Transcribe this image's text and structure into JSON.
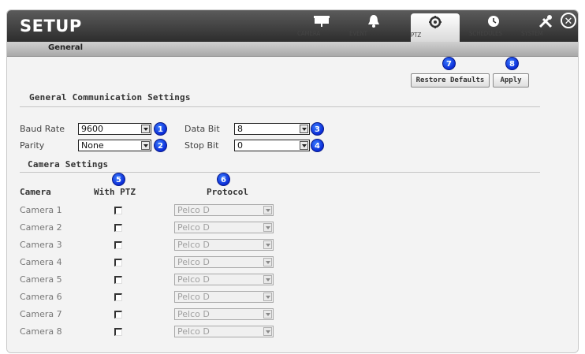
{
  "header": {
    "title": "SETUP",
    "nav": [
      {
        "label": "CAMERA",
        "icon": "camera-icon"
      },
      {
        "label": "EVENT",
        "icon": "bell-icon"
      },
      {
        "label": "PTZ",
        "icon": "ptz-icon",
        "active": true
      },
      {
        "label": "SCHEDULES",
        "icon": "clock-icon"
      },
      {
        "label": "SYSTEM",
        "icon": "tools-icon"
      }
    ],
    "close_glyph": "✕"
  },
  "subbar": {
    "tab": "General"
  },
  "toolbar": {
    "restore_label": "Restore Defaults",
    "apply_label": "Apply",
    "restore_badge": "7",
    "apply_badge": "8"
  },
  "general": {
    "title": "General Communication Settings",
    "baud_label": "Baud Rate",
    "baud_value": "9600",
    "baud_badge": "1",
    "parity_label": "Parity",
    "parity_value": "None",
    "parity_badge": "2",
    "databit_label": "Data Bit",
    "databit_value": "8",
    "databit_badge": "3",
    "stopbit_label": "Stop Bit",
    "stopbit_value": "0",
    "stopbit_badge": "4"
  },
  "camera_settings": {
    "title": "Camera Settings",
    "col_camera": "Camera",
    "col_ptz": "With PTZ",
    "col_protocol": "Protocol",
    "ptz_badge": "5",
    "protocol_badge": "6",
    "rows": [
      {
        "name": "Camera 1",
        "ptz": false,
        "protocol": "Pelco D"
      },
      {
        "name": "Camera 2",
        "ptz": false,
        "protocol": "Pelco D"
      },
      {
        "name": "Camera 3",
        "ptz": false,
        "protocol": "Pelco D"
      },
      {
        "name": "Camera 4",
        "ptz": false,
        "protocol": "Pelco D"
      },
      {
        "name": "Camera 5",
        "ptz": false,
        "protocol": "Pelco D"
      },
      {
        "name": "Camera 6",
        "ptz": false,
        "protocol": "Pelco D"
      },
      {
        "name": "Camera 7",
        "ptz": false,
        "protocol": "Pelco D"
      },
      {
        "name": "Camera 8",
        "ptz": false,
        "protocol": "Pelco D"
      }
    ]
  },
  "colors": {
    "badge": "#0a2bd6",
    "topbar": "#3a3a3a",
    "accent": "#ffffff"
  }
}
